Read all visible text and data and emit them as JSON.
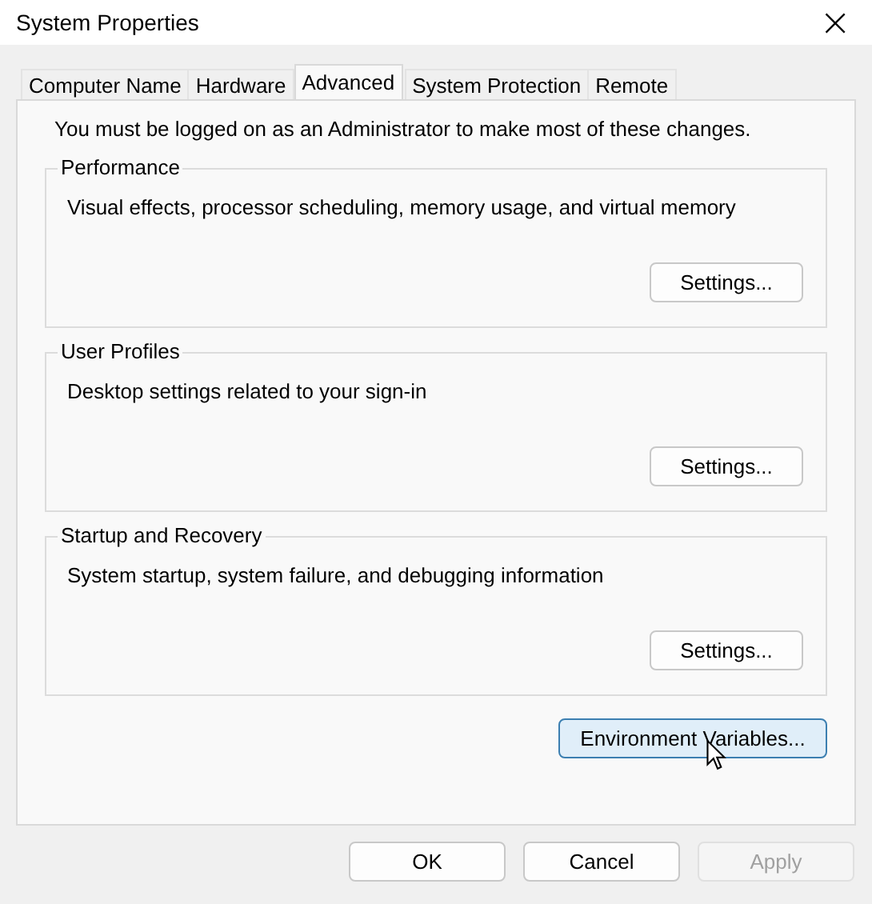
{
  "window": {
    "title": "System Properties",
    "close": "×"
  },
  "tabs": [
    {
      "label": "Computer Name",
      "selected": false
    },
    {
      "label": "Hardware",
      "selected": false
    },
    {
      "label": "Advanced",
      "selected": true
    },
    {
      "label": "System Protection",
      "selected": false
    },
    {
      "label": "Remote",
      "selected": false
    }
  ],
  "notice": "You must be logged on as an Administrator to make most of these changes.",
  "groups": [
    {
      "title": "Performance",
      "description": "Visual effects, processor scheduling, memory usage, and virtual memory",
      "button": "Settings..."
    },
    {
      "title": "User Profiles",
      "description": "Desktop settings related to your sign-in",
      "button": "Settings..."
    },
    {
      "title": "Startup and Recovery",
      "description": "System startup, system failure, and debugging information",
      "button": "Settings..."
    }
  ],
  "environment_button": {
    "label": "Environment Variables...",
    "hovered": true
  },
  "buttons": [
    {
      "label": "OK",
      "disabled": false
    },
    {
      "label": "Cancel",
      "disabled": false
    },
    {
      "label": "Apply",
      "disabled": true
    }
  ]
}
